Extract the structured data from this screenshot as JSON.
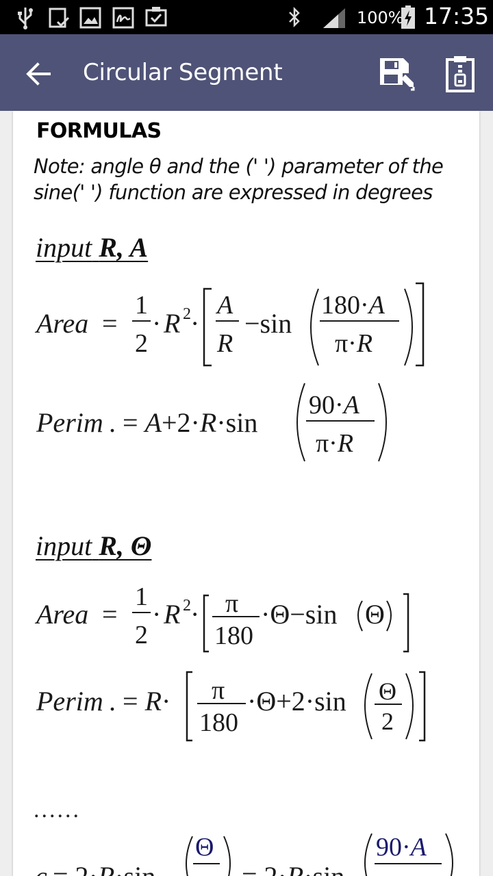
{
  "status_bar": {
    "battery_percent": "100%",
    "time": "17:35",
    "icons": [
      "usb-icon",
      "download-done-icon",
      "image-icon",
      "signature-icon",
      "clipboard-check-icon",
      "bluetooth-icon",
      "signal-icon",
      "battery-charging-icon"
    ]
  },
  "app_bar": {
    "title": "Circular Segment",
    "back_icon": "arrow-left-icon",
    "actions": [
      "save-edit-icon",
      "clipboard-zip-icon"
    ],
    "color": "#4f5377"
  },
  "content": {
    "section_title": "FORMULAS",
    "note": "Note: angle θ and the (' ') parameter of the sine(' ') function are expressed in degrees",
    "input1": {
      "prefix": "input",
      "params": "R, A"
    },
    "input2": {
      "prefix": "input",
      "params": "R, Θ"
    },
    "ellipsis": "......"
  }
}
